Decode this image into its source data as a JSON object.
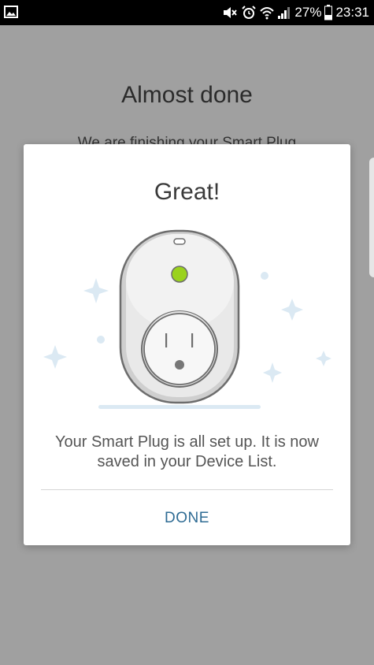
{
  "status_bar": {
    "battery": "27%",
    "time": "23:31"
  },
  "background_page": {
    "title": "Almost done",
    "subtitle": "We are finishing your Smart Plug"
  },
  "dialog": {
    "title": "Great!",
    "message": "Your Smart Plug is all set up. It is now saved in your Device List.",
    "done_label": "DONE"
  },
  "colors": {
    "accent": "#2f6c94",
    "led": "#9ad21d",
    "sparkle": "#dbe9f3"
  },
  "illustration": "smart-plug-illustration"
}
